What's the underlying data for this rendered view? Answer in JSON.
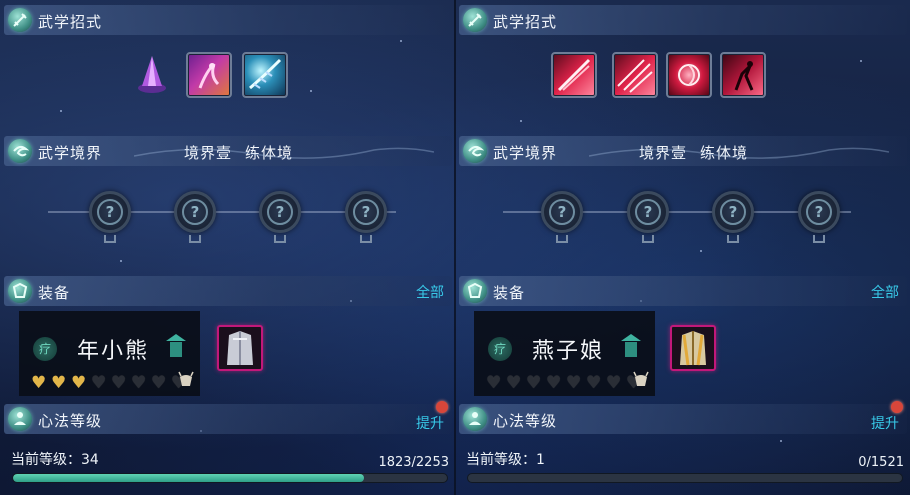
{
  "panels": [
    {
      "skills_header": "武学招式",
      "realm_header": "武学境界",
      "realm_level": "境界壹",
      "realm_stage": "练体境",
      "equip_header": "装备",
      "equip_all_link": "全部",
      "character_class": "疗",
      "character_name": "年小熊",
      "affinity_filled": 3,
      "affinity_total": 8,
      "mind_header": "心法等级",
      "mind_upgrade": "提升",
      "level_label": "当前等级：34",
      "xp_text": "1823/2253",
      "xp_progress": 0.809,
      "node_glyph": "?"
    },
    {
      "skills_header": "武学招式",
      "realm_header": "武学境界",
      "realm_level": "境界壹",
      "realm_stage": "练体境",
      "equip_header": "装备",
      "equip_all_link": "全部",
      "character_class": "疗",
      "character_name": "燕子娘",
      "affinity_filled": 0,
      "affinity_total": 8,
      "mind_header": "心法等级",
      "mind_upgrade": "提升",
      "level_label": "当前等级：1",
      "xp_text": "0/1521",
      "xp_progress": 0.0,
      "node_glyph": "?"
    }
  ],
  "colors": {
    "accent_link": "#38c9e8",
    "xp_fill": "#2f9f88",
    "equip_border": "#c2187a",
    "notify_dot": "#d8463a",
    "heart_gold": "#e2b64a"
  },
  "icons": {
    "skills_header": "sword-icon",
    "realm_header": "swirl-icon",
    "equip_header": "armor-icon",
    "mind_header": "meditation-figure-icon"
  }
}
